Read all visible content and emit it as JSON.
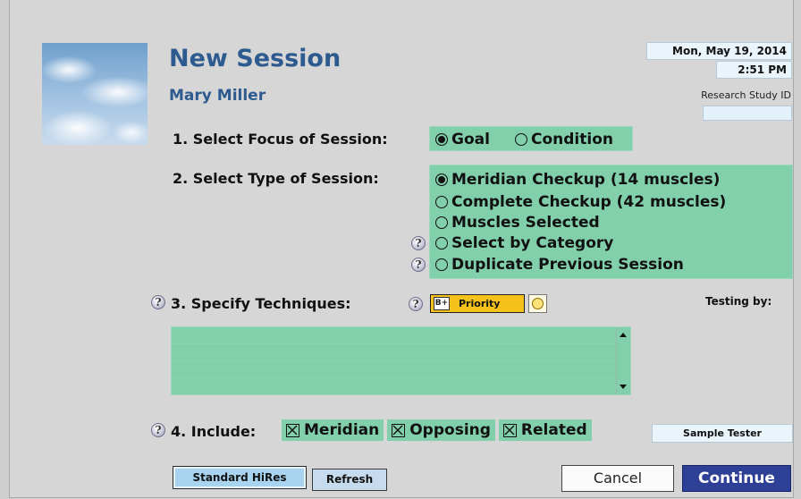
{
  "header": {
    "title": "New Session",
    "user_name": "Mary Miller",
    "date": "Mon, May 19, 2014",
    "time": "2:51 PM",
    "research_label": "Research Study ID",
    "research_value": ""
  },
  "step1": {
    "label": "1. Select Focus of Session:",
    "options": [
      {
        "label": "Goal",
        "selected": true
      },
      {
        "label": "Condition",
        "selected": false
      }
    ]
  },
  "step2": {
    "label": "2. Select Type of Session:",
    "options": [
      {
        "label": "Meridian Checkup (14 muscles)",
        "selected": true,
        "help": false
      },
      {
        "label": "Complete Checkup (42 muscles)",
        "selected": false,
        "help": false
      },
      {
        "label": "Muscles Selected",
        "selected": false,
        "help": false
      },
      {
        "label": "Select by Category",
        "selected": false,
        "help": true
      },
      {
        "label": "Duplicate Previous Session",
        "selected": false,
        "help": true
      }
    ]
  },
  "step3": {
    "label": "3. Specify Techniques:",
    "priority_label": "Priority",
    "priority_icon_text": "B+",
    "testing_label": "Testing by:",
    "tester": "Sample Tester"
  },
  "step4": {
    "label": "4. Include:",
    "items": [
      {
        "label": "Meridian",
        "checked": true
      },
      {
        "label": "Opposing",
        "checked": true
      },
      {
        "label": "Related",
        "checked": true
      }
    ]
  },
  "buttons": {
    "standard": "Standard HiRes",
    "refresh": "Refresh",
    "cancel": "Cancel",
    "continue": "Continue"
  },
  "help_glyph": "?",
  "colors": {
    "title": "#2d5b8f",
    "panel_green": "#82cfac",
    "continue_bg": "#2e3f96",
    "priority_bg": "#f4c21a"
  }
}
